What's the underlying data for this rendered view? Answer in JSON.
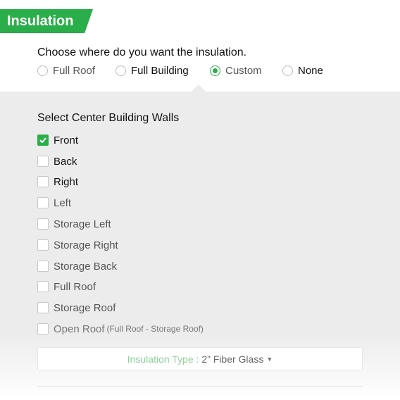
{
  "header": {
    "title": "Insulation"
  },
  "location": {
    "question": "Choose where do you want the insulation.",
    "options": [
      {
        "label": "Full Roof",
        "selected": false
      },
      {
        "label": "Full Building",
        "selected": false
      },
      {
        "label": "Custom",
        "selected": true
      },
      {
        "label": "None",
        "selected": false
      }
    ]
  },
  "walls": {
    "title": "Select Center Building Walls",
    "items": [
      {
        "label": "Front",
        "checked": true
      },
      {
        "label": "Back",
        "checked": false
      },
      {
        "label": "Right",
        "checked": false
      },
      {
        "label": "Left",
        "checked": false
      },
      {
        "label": "Storage Left",
        "checked": false
      },
      {
        "label": "Storage Right",
        "checked": false
      },
      {
        "label": "Storage Back",
        "checked": false
      },
      {
        "label": "Full Roof",
        "checked": false
      },
      {
        "label": "Storage Roof",
        "checked": false
      },
      {
        "label": "Open Roof",
        "note": "(Full Roof - Storage Roof)",
        "checked": false
      }
    ]
  },
  "insulation_type": {
    "label": "Insulation Type :",
    "value": "2” Fiber Glass"
  },
  "colors": {
    "accent": "#2aae4a",
    "panel_bg": "#ececec"
  }
}
